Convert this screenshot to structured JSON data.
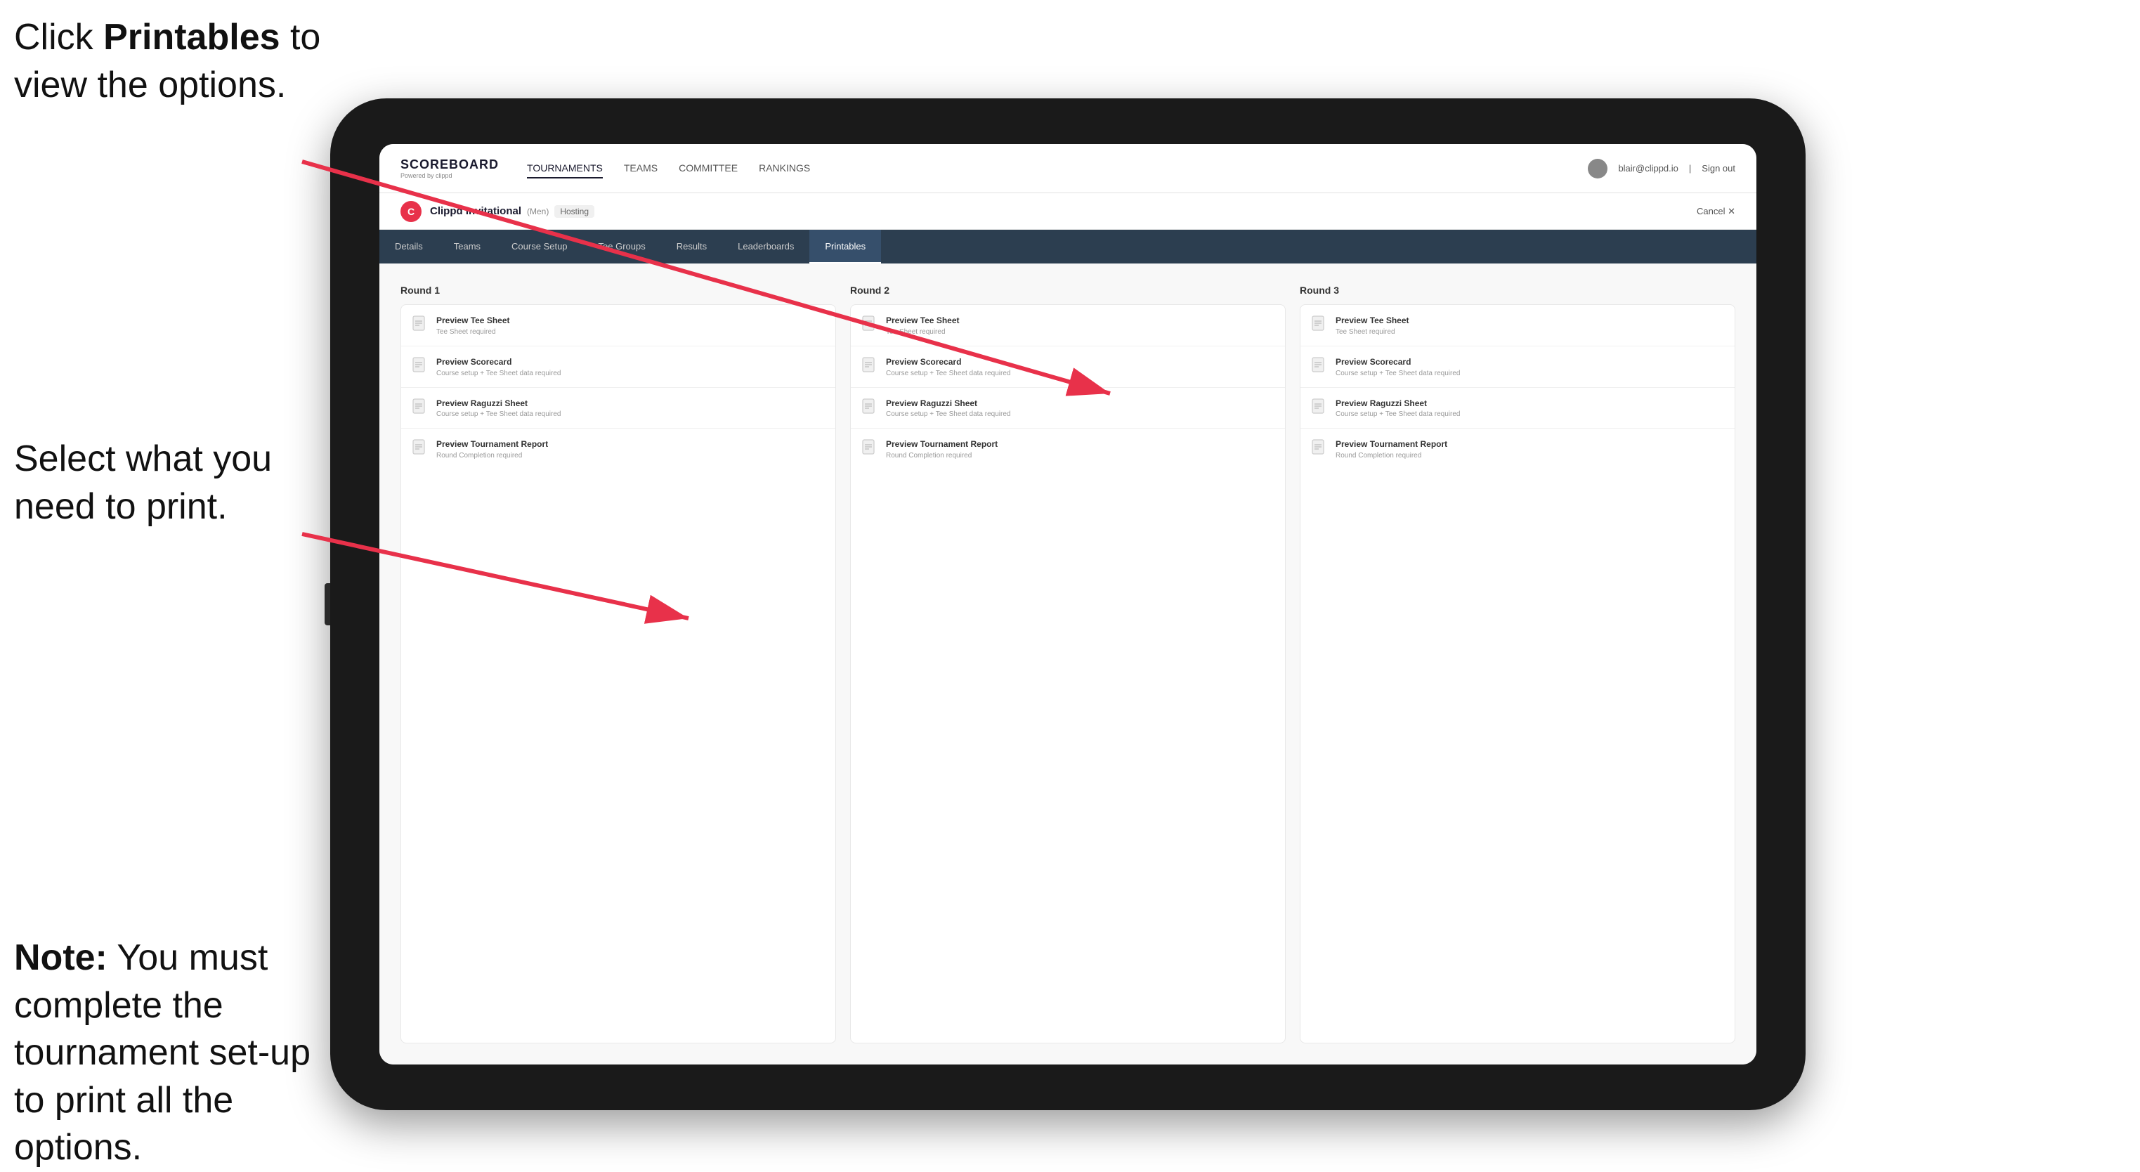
{
  "annotations": {
    "top_line1": "Click ",
    "top_bold": "Printables",
    "top_line2": " to",
    "top_line3": "view the options.",
    "mid_line1": "Select what you",
    "mid_line2": "need to print.",
    "bot_note": "Note:",
    "bot_text": " You must complete the tournament set-up to print all the options."
  },
  "topnav": {
    "logo": "SCOREBOARD",
    "logo_sub": "Powered by clippd",
    "links": [
      "TOURNAMENTS",
      "TEAMS",
      "COMMITTEE",
      "RANKINGS"
    ],
    "active_link": "TOURNAMENTS",
    "user_email": "blair@clippd.io",
    "sign_out": "Sign out"
  },
  "tournament": {
    "name": "Clippd Invitational",
    "type": "(Men)",
    "status": "Hosting",
    "cancel": "Cancel ✕"
  },
  "subtabs": {
    "tabs": [
      "Details",
      "Teams",
      "Course Setup",
      "Tee Groups",
      "Results",
      "Leaderboards",
      "Printables"
    ],
    "active": "Printables"
  },
  "rounds": [
    {
      "title": "Round 1",
      "items": [
        {
          "title": "Preview Tee Sheet",
          "sub": "Tee Sheet required"
        },
        {
          "title": "Preview Scorecard",
          "sub": "Course setup + Tee Sheet data required"
        },
        {
          "title": "Preview Raguzzi Sheet",
          "sub": "Course setup + Tee Sheet data required"
        },
        {
          "title": "Preview Tournament Report",
          "sub": "Round Completion required"
        }
      ]
    },
    {
      "title": "Round 2",
      "items": [
        {
          "title": "Preview Tee Sheet",
          "sub": "Tee Sheet required"
        },
        {
          "title": "Preview Scorecard",
          "sub": "Course setup + Tee Sheet data required"
        },
        {
          "title": "Preview Raguzzi Sheet",
          "sub": "Course setup + Tee Sheet data required"
        },
        {
          "title": "Preview Tournament Report",
          "sub": "Round Completion required"
        }
      ]
    },
    {
      "title": "Round 3",
      "items": [
        {
          "title": "Preview Tee Sheet",
          "sub": "Tee Sheet required"
        },
        {
          "title": "Preview Scorecard",
          "sub": "Course setup + Tee Sheet data required"
        },
        {
          "title": "Preview Raguzzi Sheet",
          "sub": "Course setup + Tee Sheet data required"
        },
        {
          "title": "Preview Tournament Report",
          "sub": "Round Completion required"
        }
      ]
    }
  ]
}
